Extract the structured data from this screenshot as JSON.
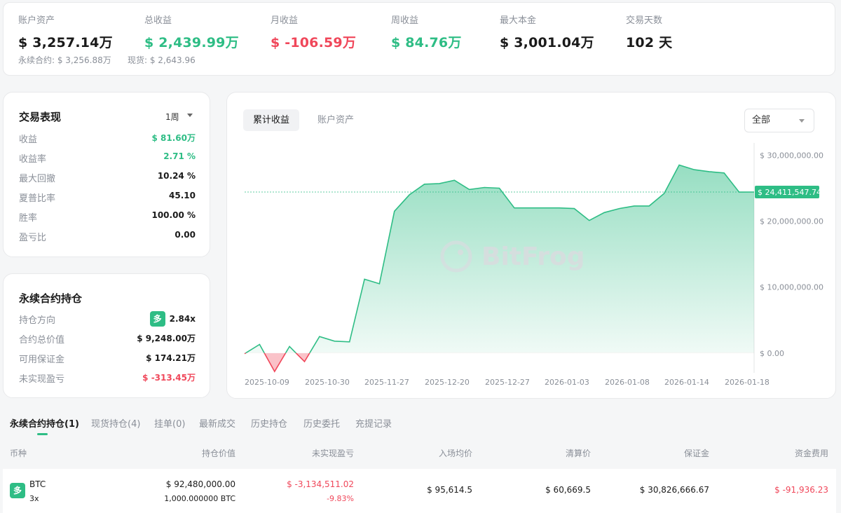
{
  "stats": {
    "account_assets": {
      "label": "账户资产",
      "value": "$ 3,257.14万"
    },
    "total_pnl": {
      "label": "总收益",
      "value": "$ 2,439.99万"
    },
    "monthly_pnl": {
      "label": "月收益",
      "value": "$ -106.59万"
    },
    "weekly_pnl": {
      "label": "周收益",
      "value": "$ 84.76万"
    },
    "max_principal": {
      "label": "最大本金",
      "value": "$ 3,001.04万"
    },
    "trading_days": {
      "label": "交易天数",
      "value": "102 天"
    },
    "perpetual_sub": "永续合约: $ 3,256.88万",
    "spot_sub": "现货: $ 2,643.96"
  },
  "performance": {
    "title": "交易表现",
    "period": "1周",
    "rows": [
      {
        "k": "收益",
        "v": "$ 81.60万"
      },
      {
        "k": "收益率",
        "v": "2.71 %"
      },
      {
        "k": "最大回撤",
        "v": "10.24 %"
      },
      {
        "k": "夏普比率",
        "v": "45.10"
      },
      {
        "k": "胜率",
        "v": "100.00 %"
      },
      {
        "k": "盈亏比",
        "v": "0.00"
      }
    ]
  },
  "positions": {
    "title": "永续合约持仓",
    "rows": [
      {
        "k": "持仓方向",
        "badge": "多",
        "v": "2.84x"
      },
      {
        "k": "合约总价值",
        "v": "$ 9,248.00万"
      },
      {
        "k": "可用保证金",
        "v": "$ 174.21万"
      },
      {
        "k": "未实现盈亏",
        "v": "$ -313.45万"
      }
    ]
  },
  "chart_tabs": {
    "cumulative": "累计收益",
    "assets": "账户资产"
  },
  "range_select": "全部",
  "watermark": "BitFrog",
  "chart_data": {
    "type": "area",
    "x": [
      "2025-10-09",
      "2025-10-30",
      "2025-11-27",
      "2025-12-20",
      "2025-12-27",
      "2026-01-03",
      "2026-01-08",
      "2026-01-14",
      "2026-01-18"
    ],
    "ytick_labels": [
      "$ 30,000,000.00",
      "$ 20,000,000.00",
      "$ 10,000,000.00",
      "$ 0.00"
    ],
    "yticks": [
      30000000,
      20000000,
      10000000,
      0
    ],
    "ylim": [
      -3000000,
      31000000
    ],
    "current_label": "$ 24,411,547.74",
    "current_value": 24411547.74,
    "values": [
      -100000,
      1300000,
      -2800000,
      1000000,
      -1300000,
      2500000,
      1800000,
      1700000,
      11200000,
      10500000,
      21500000,
      24000000,
      25600000,
      25700000,
      26200000,
      24800000,
      25100000,
      25000000,
      22000000,
      22000000,
      22000000,
      22000000,
      21900000,
      20100000,
      21300000,
      21900000,
      22300000,
      22300000,
      24200000,
      28500000,
      27800000,
      27500000,
      27300000,
      24400000,
      24411547.74
    ],
    "colors": {
      "up": "#2ebd85",
      "down": "#f0475a"
    }
  },
  "bottom_tabs": [
    "永续合约持仓(1)",
    "现货持仓(4)",
    "挂单(0)",
    "最新成交",
    "历史持仓",
    "历史委托",
    "充提记录"
  ],
  "table": {
    "headers": [
      "币种",
      "持仓价值",
      "未实现盈亏",
      "入场均价",
      "清算价",
      "保证金",
      "资金费用"
    ],
    "row": {
      "badge": "多",
      "coin": "BTC",
      "leverage": "3x",
      "position_value": "$ 92,480,000.00",
      "position_qty": "1,000.000000 BTC",
      "upnl": "$ -3,134,511.02",
      "upnl_pct": "-9.83%",
      "entry_price": "$ 95,614.5",
      "liq_price": "$ 60,669.5",
      "margin": "$ 30,826,666.67",
      "funding_fee": "$ -91,936.23"
    }
  }
}
